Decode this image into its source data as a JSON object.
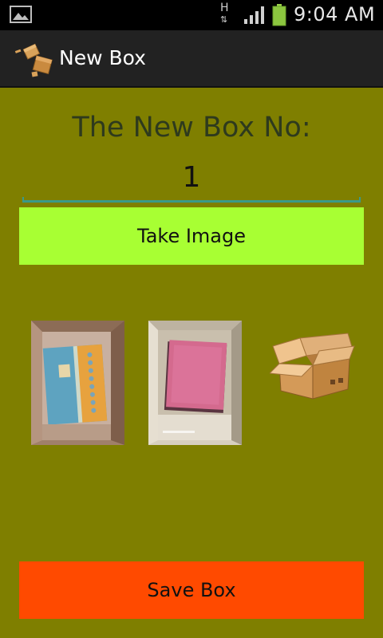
{
  "status_bar": {
    "network_type": "H",
    "network_arrows": "⇅",
    "time": "9:04 AM",
    "icons": [
      "gallery-notification-icon",
      "signal-icon",
      "battery-icon"
    ],
    "battery_color": "#8cc63f"
  },
  "action_bar": {
    "title": "New Box",
    "icon": "boxes-app-icon"
  },
  "form": {
    "heading": "The New Box No:",
    "box_number": "1",
    "take_image_label": "Take Image",
    "save_box_label": "Save Box"
  },
  "images": [
    {
      "name": "box-photo-1",
      "content": "blue book in cardboard box"
    },
    {
      "name": "box-photo-2",
      "content": "pink book in cardboard box"
    }
  ],
  "colors": {
    "background": "#7f7f00",
    "take_button": "#a8ff33",
    "save_button": "#ff4a00",
    "action_bar": "#222222",
    "accent": "#3a9a8a"
  }
}
